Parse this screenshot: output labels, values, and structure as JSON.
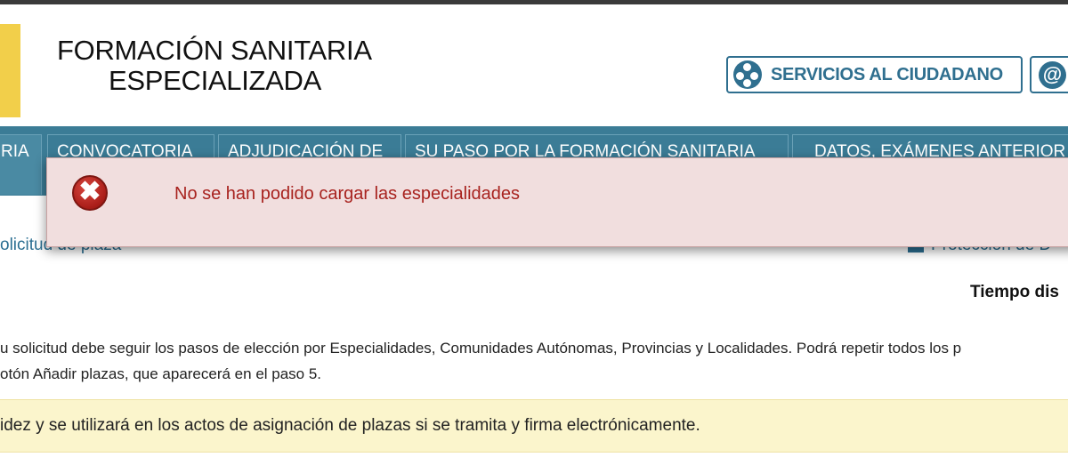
{
  "header": {
    "title_line1": "FORMACIÓN SANITARIA",
    "title_line2": "ESPECIALIZADA",
    "services_button": "SERVICIOS AL CIUDADANO",
    "services_icon": "people-icon",
    "email_icon_glyph": "@",
    "brand_yellow": "#f2cf4a",
    "accent": "#2f6f8f"
  },
  "nav": {
    "tabs": [
      {
        "label": "RIA"
      },
      {
        "label": "CONVOCATORIA"
      },
      {
        "label": "ADJUDICACIÓN DE"
      },
      {
        "label": "SU PASO POR LA FORMACIÓN SANITARIA"
      },
      {
        "label": "DATOS, EXÁMENES ANTERIOR"
      }
    ],
    "color": "#3b7c96"
  },
  "error_toast": {
    "icon": "error-icon",
    "glyph": "✖",
    "message": "No se han podido cargar las especialidades"
  },
  "breadcrumb": "olicitud de plaza",
  "protection_link": "Protección de D",
  "timer_label": "Tiempo dis",
  "instructions": {
    "line1": "u solicitud debe seguir los pasos de elección por Especialidades, Comunidades Autónomas, Provincias y Localidades. Podrá repetir todos los p",
    "line2": "otón Añadir plazas, que aparecerá en el paso 5."
  },
  "notice": "idez y se utilizará en los actos de asignación de plazas si se tramita y firma electrónicamente."
}
